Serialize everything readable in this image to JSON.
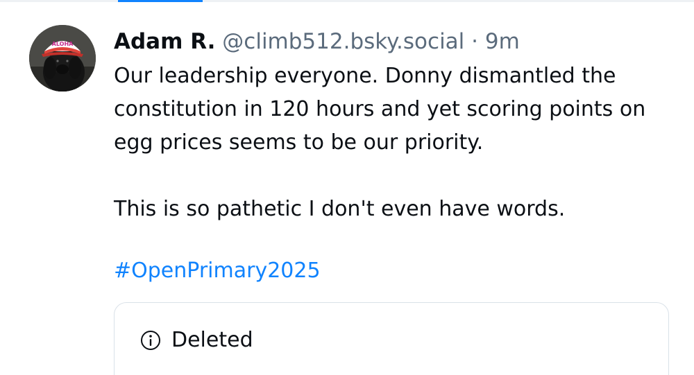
{
  "post": {
    "author_name": "Adam R.",
    "author_handle": "@climb512.bsky.social",
    "separator": "·",
    "timestamp": "9m",
    "paragraphs": [
      "Our leadership everyone. Donny dismantled the constitution in 120 hours and yet scoring points on egg prices seems to be our priority.",
      "This is so pathetic I don't even have words."
    ],
    "hashtag": "#OpenPrimary2025",
    "avatar": {
      "icon": "avatar-dog-in-cap",
      "cap_text": "ALOHA"
    }
  },
  "embed": {
    "icon": "info-circle-icon",
    "label": "Deleted"
  },
  "colors": {
    "text_primary": "#0b0f14",
    "text_secondary": "#5b6b7c",
    "link": "#1083fe",
    "border": "#d9e1e8"
  }
}
